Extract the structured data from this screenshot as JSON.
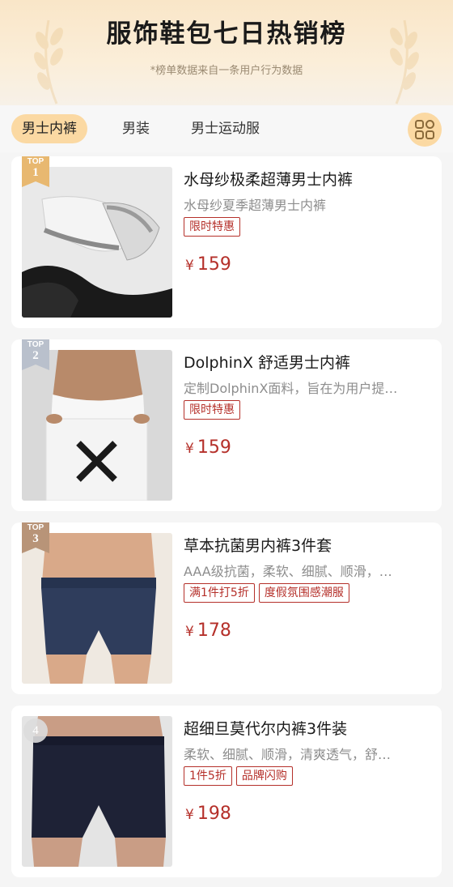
{
  "header": {
    "title": "服饰鞋包七日热销榜",
    "subtitle": "*榜单数据来自一条用户行为数据"
  },
  "tabs": [
    {
      "label": "男士内裤",
      "active": true
    },
    {
      "label": "男装",
      "active": false
    },
    {
      "label": "男士运动服",
      "active": false
    }
  ],
  "grid_button": {
    "icon": "grid-icon"
  },
  "colors": {
    "accent": "#fbd9a3",
    "price": "#b5302a",
    "top1": "#e8b870",
    "top2": "#b9c0cc",
    "top3": "#b89478"
  },
  "products": [
    {
      "rank_label": "TOP",
      "rank": "1",
      "name": "水母纱极柔超薄男士内裤",
      "desc": "水母纱夏季超薄男士内裤",
      "tags": [
        "限时特惠"
      ],
      "currency": "¥",
      "price": "159"
    },
    {
      "rank_label": "TOP",
      "rank": "2",
      "name": "DolphinX 舒适男士内裤",
      "desc": "定制DolphinX面料，旨在为用户提…",
      "tags": [
        "限时特惠"
      ],
      "currency": "¥",
      "price": "159"
    },
    {
      "rank_label": "TOP",
      "rank": "3",
      "name": "草本抗菌男内裤3件套",
      "desc": "AAA级抗菌，柔软、细腻、顺滑，…",
      "tags": [
        "满1件打5折",
        "度假氛围感潮服"
      ],
      "currency": "¥",
      "price": "178"
    },
    {
      "rank_label": "",
      "rank": "4",
      "name": "超细旦莫代尔内裤3件装",
      "desc": "柔软、细腻、顺滑，清爽透气，舒…",
      "tags": [
        "1件5折",
        "品牌闪购"
      ],
      "currency": "¥",
      "price": "198"
    }
  ]
}
